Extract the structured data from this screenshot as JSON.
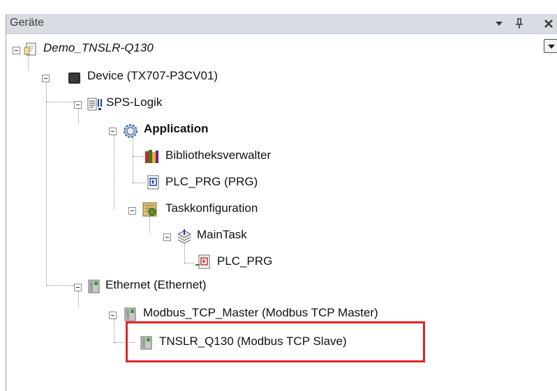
{
  "panel": {
    "title": "Geräte",
    "buttons": {
      "dropdown": "▾",
      "pin": "ꟼ",
      "close": "✕"
    }
  },
  "tree": {
    "root": {
      "label": "Demo_TNSLR-Q130",
      "icon": "project-icon"
    },
    "device": {
      "label": "Device (TX707-P3CV01)",
      "icon": "device-icon"
    },
    "plc_logic": {
      "label": "SPS-Logik",
      "icon": "plc-logic-icon"
    },
    "application": {
      "label": "Application",
      "icon": "application-gear-icon"
    },
    "library_manager": {
      "label": "Bibliotheksverwalter",
      "icon": "library-books-icon"
    },
    "plc_prg": {
      "label": "PLC_PRG (PRG)",
      "icon": "pou-icon"
    },
    "task_config": {
      "label": "Taskkonfiguration",
      "icon": "task-config-icon"
    },
    "main_task": {
      "label": "MainTask",
      "icon": "task-icon"
    },
    "task_plc_prg": {
      "label": "PLC_PRG",
      "icon": "program-call-icon"
    },
    "ethernet": {
      "label": "Ethernet (Ethernet)",
      "icon": "network-device-icon"
    },
    "modbus_master": {
      "label": "Modbus_TCP_Master (Modbus TCP Master)",
      "icon": "network-device-icon"
    },
    "modbus_slave": {
      "label": "TNSLR_Q130 (Modbus TCP Slave)",
      "icon": "network-device-icon"
    }
  },
  "colors": {
    "highlight": "#e32228",
    "titlebar": "#d9dce2"
  }
}
